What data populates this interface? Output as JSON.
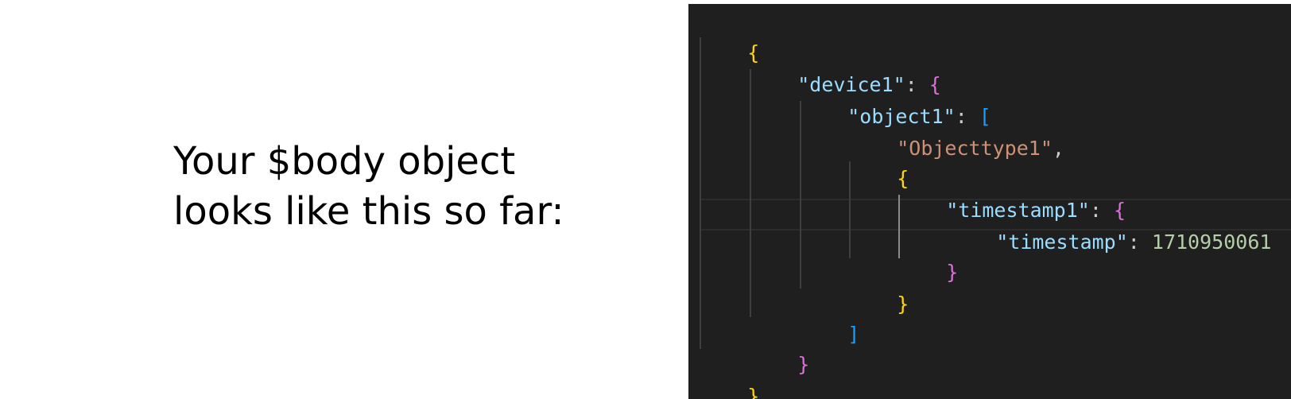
{
  "caption": {
    "line1": "Your $body object",
    "line2": "looks like this so far:"
  },
  "code": {
    "open_root": "{",
    "key_device": "\"device1\"",
    "colon": ": ",
    "open_device": "{",
    "key_object": "\"object1\"",
    "open_array": "[",
    "str_objecttype": "\"Objecttype1\"",
    "comma": ",",
    "open_obj": "{",
    "key_timestamp1": "\"timestamp1\"",
    "open_ts1": "{",
    "key_timestamp": "\"timestamp\"",
    "value_timestamp": "1710950061",
    "close_ts1": "}",
    "close_obj": "}",
    "close_array": "]",
    "close_device": "}",
    "close_root": "}"
  },
  "colors": {
    "editor_bg": "#1f1f1f",
    "brace_level1": "#ffd700",
    "brace_level2": "#da70d6",
    "bracket_level3": "#179fff",
    "json_key": "#9cdcfe",
    "json_string": "#ce9178",
    "json_number": "#b5cea8"
  }
}
